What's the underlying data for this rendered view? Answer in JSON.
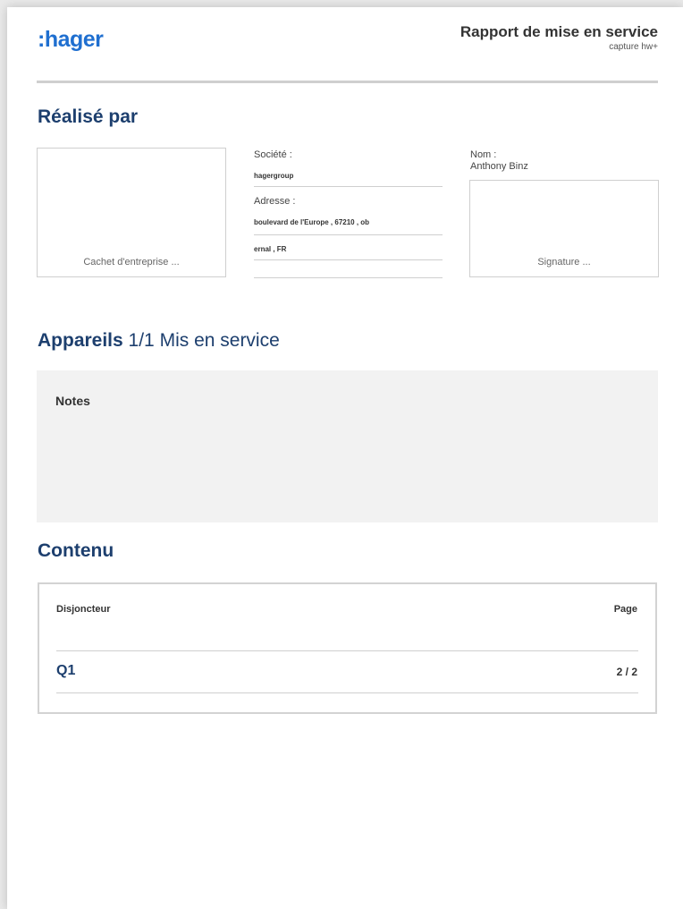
{
  "header": {
    "logo": ":hager",
    "title": "Rapport de mise en service",
    "subtitle": "capture hw+"
  },
  "realise": {
    "heading": "Réalisé par",
    "stamp_caption": "Cachet d'entreprise ...",
    "societe_label": "Société :",
    "societe_value": "hagergroup",
    "adresse_label": "Adresse :",
    "adresse_value": "boulevard de l'Europe , 67210 , ob",
    "adresse_value2": "ernal , FR",
    "nom_label": "Nom :",
    "nom_value": "Anthony Binz",
    "signature_caption": "Signature ..."
  },
  "appareils": {
    "heading_bold": "Appareils",
    "heading_rest": "1/1 Mis en service",
    "notes_label": "Notes"
  },
  "contenu": {
    "heading": "Contenu",
    "col_left": "Disjoncteur",
    "col_right": "Page",
    "rows": [
      {
        "name": "Q1",
        "page": "2 / 2"
      }
    ]
  }
}
